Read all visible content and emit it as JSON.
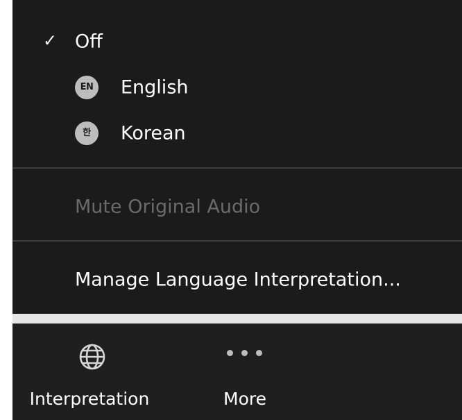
{
  "menu": {
    "items": [
      {
        "label": "Off",
        "checked": true
      },
      {
        "label": "English",
        "badge": "EN"
      },
      {
        "label": "Korean",
        "badge": "한"
      }
    ],
    "mute_label": "Mute Original Audio",
    "mute_disabled": true,
    "manage_label": "Manage Language Interpretation..."
  },
  "toolbar": {
    "interpretation_label": "Interpretation",
    "interpretation_icon": "globe-icon",
    "more_label": "More",
    "more_icon": "more-dots-icon"
  },
  "colors": {
    "menu_bg": "#1b1b1b",
    "toolbar_bg": "#1f1f1f",
    "disabled_text": "#6b6b6b",
    "badge_bg": "#bdbdbd"
  }
}
